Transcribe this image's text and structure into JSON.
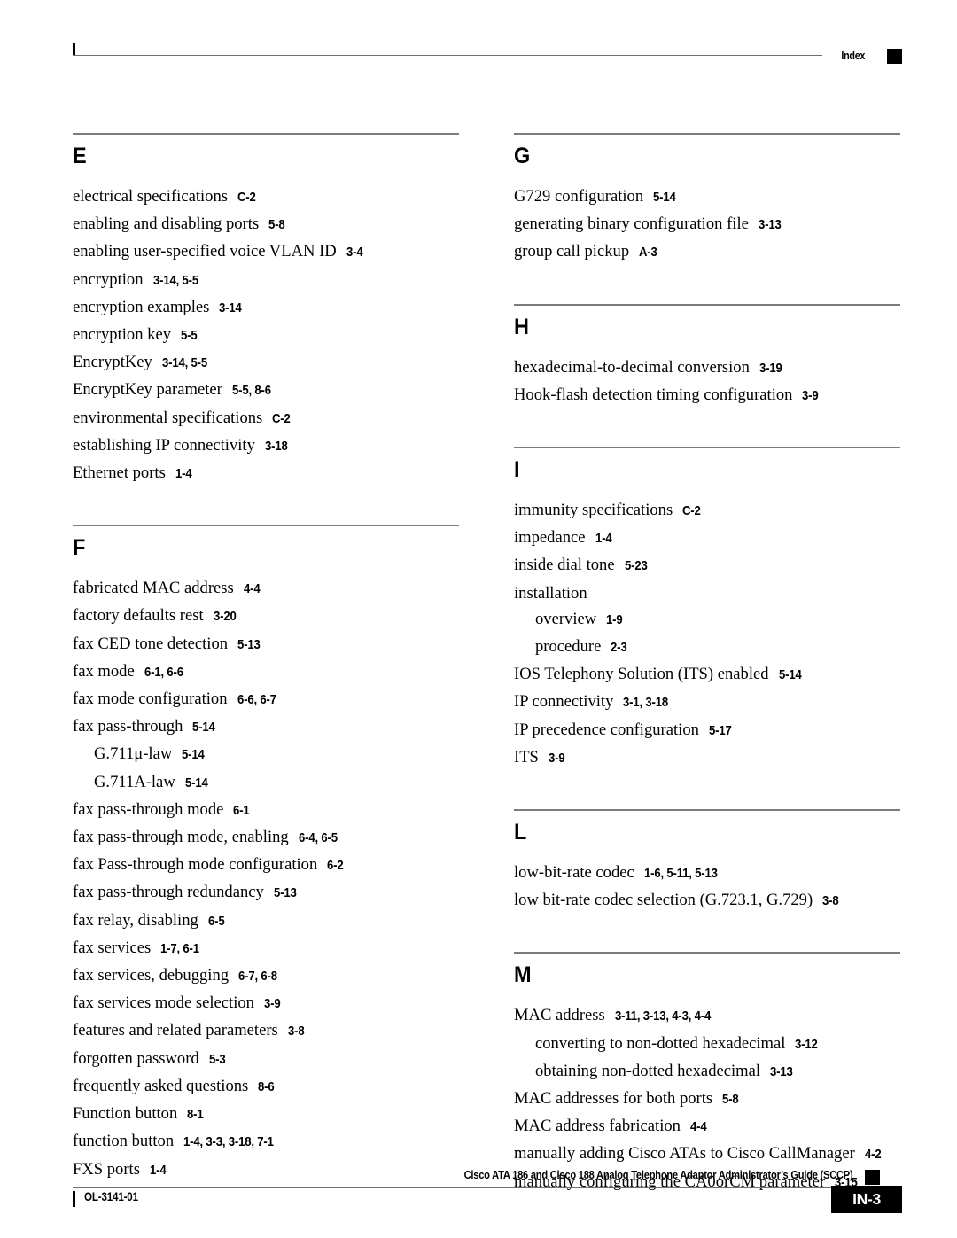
{
  "header": {
    "label": "Index"
  },
  "footer": {
    "title": "Cisco ATA 186 and Cisco 188 Analog Telephone Adaptor Administrator’s Guide (SCCP)",
    "doc_id": "OL-3141-01",
    "page_number": "IN-3"
  },
  "columns": [
    {
      "groups": [
        {
          "letter": "E",
          "entries": [
            {
              "term": "electrical specifications",
              "refs": "C-2",
              "level": 0
            },
            {
              "term": "enabling and disabling ports",
              "refs": "5-8",
              "level": 0
            },
            {
              "term": "enabling user-specified voice VLAN ID",
              "refs": "3-4",
              "level": 0
            },
            {
              "term": "encryption",
              "refs": "3-14, 5-5",
              "level": 0
            },
            {
              "term": "encryption examples",
              "refs": "3-14",
              "level": 0
            },
            {
              "term": "encryption key",
              "refs": "5-5",
              "level": 0
            },
            {
              "term": "EncryptKey",
              "refs": "3-14, 5-5",
              "level": 0
            },
            {
              "term": "EncryptKey parameter",
              "refs": "5-5, 8-6",
              "level": 0
            },
            {
              "term": "environmental specifications",
              "refs": "C-2",
              "level": 0
            },
            {
              "term": "establishing IP connectivity",
              "refs": "3-18",
              "level": 0
            },
            {
              "term": "Ethernet ports",
              "refs": "1-4",
              "level": 0
            }
          ]
        },
        {
          "letter": "F",
          "entries": [
            {
              "term": "fabricated MAC address",
              "refs": "4-4",
              "level": 0
            },
            {
              "term": "factory defaults rest",
              "refs": "3-20",
              "level": 0
            },
            {
              "term": "fax CED tone detection",
              "refs": "5-13",
              "level": 0
            },
            {
              "term": "fax mode",
              "refs": "6-1, 6-6",
              "level": 0
            },
            {
              "term": "fax mode configuration",
              "refs": "6-6, 6-7",
              "level": 0
            },
            {
              "term": "fax pass-through",
              "refs": "5-14",
              "level": 0
            },
            {
              "term": "G.711μ-law",
              "refs": "5-14",
              "level": 1
            },
            {
              "term": "G.711A-law",
              "refs": "5-14",
              "level": 1
            },
            {
              "term": "fax pass-through mode",
              "refs": "6-1",
              "level": 0
            },
            {
              "term": "fax pass-through mode, enabling",
              "refs": "6-4, 6-5",
              "level": 0
            },
            {
              "term": "fax Pass-through mode configuration",
              "refs": "6-2",
              "level": 0
            },
            {
              "term": "fax pass-through redundancy",
              "refs": "5-13",
              "level": 0
            },
            {
              "term": "fax relay, disabling",
              "refs": "6-5",
              "level": 0
            },
            {
              "term": "fax services",
              "refs": "1-7, 6-1",
              "level": 0
            },
            {
              "term": "fax services, debugging",
              "refs": "6-7, 6-8",
              "level": 0
            },
            {
              "term": "fax services mode selection",
              "refs": "3-9",
              "level": 0
            },
            {
              "term": "features and related parameters",
              "refs": "3-8",
              "level": 0
            },
            {
              "term": "forgotten password",
              "refs": "5-3",
              "level": 0
            },
            {
              "term": "frequently asked questions",
              "refs": "8-6",
              "level": 0
            },
            {
              "term": "Function button",
              "refs": "8-1",
              "level": 0
            },
            {
              "term": "function button",
              "refs": "1-4, 3-3, 3-18, 7-1",
              "level": 0
            },
            {
              "term": "FXS ports",
              "refs": "1-4",
              "level": 0
            }
          ]
        }
      ]
    },
    {
      "groups": [
        {
          "letter": "G",
          "entries": [
            {
              "term": "G729 configuration",
              "refs": "5-14",
              "level": 0
            },
            {
              "term": "generating binary configuration file",
              "refs": "3-13",
              "level": 0
            },
            {
              "term": "group call pickup",
              "refs": "A-3",
              "level": 0
            }
          ]
        },
        {
          "letter": "H",
          "entries": [
            {
              "term": "hexadecimal-to-decimal conversion",
              "refs": "3-19",
              "level": 0
            },
            {
              "term": "Hook-flash detection timing configuration",
              "refs": "3-9",
              "level": 0
            }
          ]
        },
        {
          "letter": "I",
          "entries": [
            {
              "term": "immunity specifications",
              "refs": "C-2",
              "level": 0
            },
            {
              "term": "impedance",
              "refs": "1-4",
              "level": 0
            },
            {
              "term": "inside dial tone",
              "refs": "5-23",
              "level": 0
            },
            {
              "term": "installation",
              "refs": "",
              "level": 0
            },
            {
              "term": "overview",
              "refs": "1-9",
              "level": 1
            },
            {
              "term": "procedure",
              "refs": "2-3",
              "level": 1
            },
            {
              "term": "IOS Telephony Solution (ITS) enabled",
              "refs": "5-14",
              "level": 0
            },
            {
              "term": "IP connectivity",
              "refs": "3-1, 3-18",
              "level": 0
            },
            {
              "term": "IP precedence configuration",
              "refs": "5-17",
              "level": 0
            },
            {
              "term": "ITS",
              "refs": "3-9",
              "level": 0
            }
          ]
        },
        {
          "letter": "L",
          "entries": [
            {
              "term": "low-bit-rate codec",
              "refs": "1-6, 5-11, 5-13",
              "level": 0
            },
            {
              "term": "low bit-rate codec selection (G.723.1, G.729)",
              "refs": "3-8",
              "level": 0
            }
          ]
        },
        {
          "letter": "M",
          "entries": [
            {
              "term": "MAC address",
              "refs": "3-11, 3-13, 4-3, 4-4",
              "level": 0
            },
            {
              "term": "converting to non-dotted hexadecimal",
              "refs": "3-12",
              "level": 1
            },
            {
              "term": "obtaining non-dotted hexadecimal",
              "refs": "3-13",
              "level": 1
            },
            {
              "term": "MAC addresses for both ports",
              "refs": "5-8",
              "level": 0
            },
            {
              "term": "MAC address fabrication",
              "refs": "4-4",
              "level": 0
            },
            {
              "term": "manually adding Cisco ATAs to Cisco CallManager",
              "refs": "4-2",
              "level": 0
            },
            {
              "term": "manually configuring the CA0orCM parameter",
              "refs": "3-15",
              "level": 0
            }
          ]
        }
      ]
    }
  ]
}
